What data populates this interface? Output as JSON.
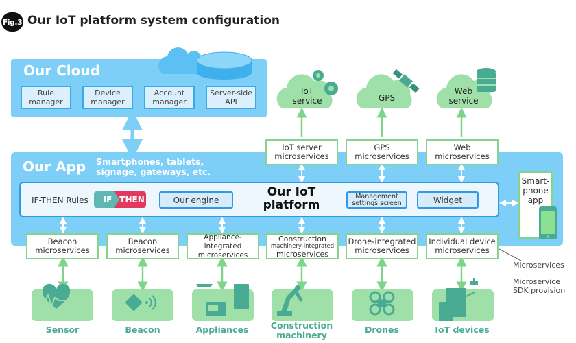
{
  "figure": {
    "badge": "Fig.3",
    "title": "Our IoT platform system configuration"
  },
  "cloud": {
    "title": "Our Cloud",
    "boxes": [
      {
        "line1": "Rule",
        "line2": "manager"
      },
      {
        "line1": "Device",
        "line2": "manager"
      },
      {
        "line1": "Account",
        "line2": "manager"
      },
      {
        "line1": "Server-side",
        "line2": "API"
      }
    ]
  },
  "external_services": [
    {
      "line1": "IoT",
      "line2": "service",
      "icon": "gears-icon"
    },
    {
      "line1": "GPS",
      "line2": "",
      "icon": "satellite-icon"
    },
    {
      "line1": "Web",
      "line2": "service",
      "icon": "database-icon"
    }
  ],
  "server_microservices": [
    {
      "line1": "IoT server",
      "line2": "microservices"
    },
    {
      "line1": "GPS",
      "line2": "microservices"
    },
    {
      "line1": "Web",
      "line2": "microservices"
    }
  ],
  "app": {
    "title": "Our App",
    "subtitle_line1": "Smartphones, tablets,",
    "subtitle_line2": "signage, gateways, etc.",
    "platform": {
      "title_line1": "Our IoT",
      "title_line2": "platform",
      "rules_label": "IF-THEN Rules",
      "if_chip": "IF",
      "then_chip": "THEN",
      "engine": "Our engine",
      "management_line1": "Management",
      "management_line2": "settings screen",
      "widget": "Widget"
    },
    "smartphone": {
      "line1": "Smart-",
      "line2": "phone",
      "line3": "app"
    }
  },
  "device_microservices": [
    {
      "line1": "Beacon",
      "line2": "microservices",
      "line3": ""
    },
    {
      "line1": "Beacon",
      "line2": "microservices",
      "line3": ""
    },
    {
      "line1": "Appliance-integrated",
      "line2": "microservices",
      "line3": ""
    },
    {
      "line1": "Construction",
      "line2": "machinery-integrated",
      "line3": "microservices"
    },
    {
      "line1": "Drone-integrated",
      "line2": "microservices",
      "line3": ""
    },
    {
      "line1": "Individual device",
      "line2": "microservices",
      "line3": ""
    }
  ],
  "devices": [
    {
      "label_line1": "Sensor",
      "label_line2": "",
      "icon": "heart-pulse-icon"
    },
    {
      "label_line1": "Beacon",
      "label_line2": "",
      "icon": "beacon-signal-icon"
    },
    {
      "label_line1": "Appliances",
      "label_line2": "",
      "icon": "appliances-icon"
    },
    {
      "label_line1": "Construction",
      "label_line2": "machinery",
      "icon": "robot-arm-icon"
    },
    {
      "label_line1": "Drones",
      "label_line2": "",
      "icon": "drone-icon"
    },
    {
      "label_line1": "IoT devices",
      "label_line2": "",
      "icon": "printer-icon"
    }
  ],
  "legend": {
    "microservices": "Microservices",
    "sdk_line1": "Microservice",
    "sdk_line2": "SDK provision"
  },
  "colors": {
    "cloud_blue": "#7dcff7",
    "border_blue": "#2f9be6",
    "green": "#83d48c",
    "device_green": "#9fe0a8",
    "icon_teal": "#4aab94",
    "if_teal": "#5fb7b4",
    "then_red": "#e23a5c"
  }
}
